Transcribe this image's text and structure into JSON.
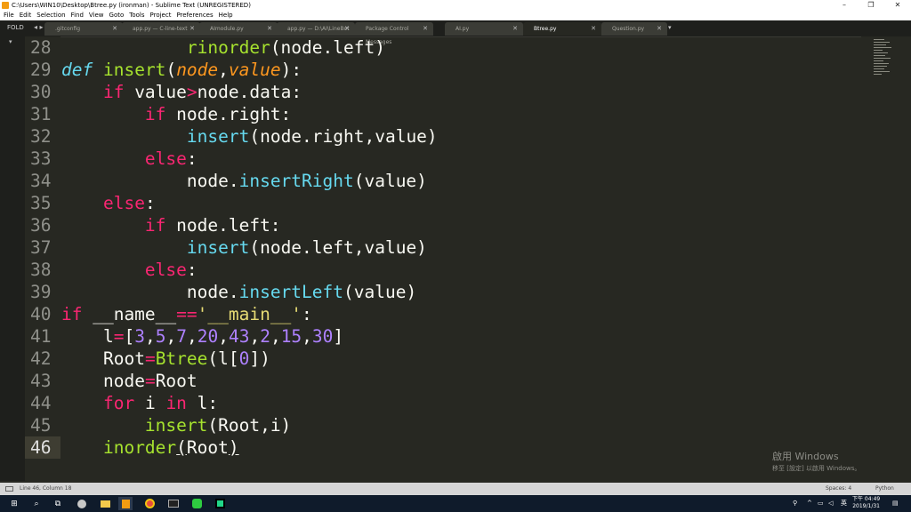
{
  "window": {
    "title": "C:\\Users\\WIN10\\Desktop\\Btree.py (ironman) - Sublime Text (UNREGISTERED)",
    "controls": [
      "–",
      "❐",
      "✕"
    ]
  },
  "menu": [
    "File",
    "Edit",
    "Selection",
    "Find",
    "View",
    "Goto",
    "Tools",
    "Project",
    "Preferences",
    "Help"
  ],
  "sidebar": {
    "label": "FOLD"
  },
  "tabs": [
    {
      "label": ".gitconfig"
    },
    {
      "label": "app.py — C-line-text"
    },
    {
      "label": "AImodule.py"
    },
    {
      "label": "app.py — D:\\AI\\LineBot"
    },
    {
      "label": "Package Control Messages"
    },
    {
      "label": "AI.py"
    },
    {
      "label": "Btree.py"
    },
    {
      "label": "Question.py"
    }
  ],
  "editor": {
    "line_numbers": [
      "28",
      "29",
      "30",
      "31",
      "32",
      "33",
      "34",
      "35",
      "36",
      "37",
      "38",
      "39",
      "40",
      "41",
      "42",
      "43",
      "44",
      "45",
      "46"
    ],
    "lines": {
      "l28": {
        "fn": "rinorder",
        "rest": "(node.left)"
      },
      "l29": {
        "kw": "def",
        "fn": "insert",
        "p1": "(",
        "a1": "node",
        "c": ",",
        "a2": "value",
        "p2": "):"
      },
      "l30": {
        "kw": "if",
        "a": " value",
        "op": ">",
        "b": "node.data:"
      },
      "l31": {
        "kw": "if",
        "rest": " node.right:"
      },
      "l32": {
        "fn": "insert",
        "rest": "(node.right,value)"
      },
      "l33": {
        "kw": "else",
        "rest": ":"
      },
      "l34": {
        "a": "node.",
        "fn": "insertRight",
        "rest": "(value)"
      },
      "l35": {
        "kw": "else",
        "rest": ":"
      },
      "l36": {
        "kw": "if",
        "rest": " node.left:"
      },
      "l37": {
        "fn": "insert",
        "rest": "(node.left,value)"
      },
      "l38": {
        "kw": "else",
        "rest": ":"
      },
      "l39": {
        "a": "node.",
        "fn": "insertLeft",
        "rest": "(value)"
      },
      "l40": {
        "kw": "if",
        "a": " __name__",
        "op": "==",
        "str": "'__main__'",
        "rest": ":"
      },
      "l41": {
        "a": "l",
        "op": "=",
        "b": "[",
        "nums": [
          "3",
          "5",
          "7",
          "20",
          "43",
          "2",
          "15",
          "30"
        ],
        "c": "]"
      },
      "l42": {
        "a": "Root",
        "op": "=",
        "fn": "Btree",
        "b": "(l[",
        "num": "0",
        "c": "])"
      },
      "l43": {
        "a": "node",
        "op": "=",
        "b": "Root"
      },
      "l44": {
        "kw1": "for",
        "a": " i ",
        "kw2": "in",
        "b": " l:"
      },
      "l45": {
        "fn": "insert",
        "rest": "(Root,i)"
      },
      "l46": {
        "fn": "inorder",
        "p1": "(",
        "a": "Root",
        "p2": ")"
      }
    }
  },
  "watermark": {
    "line1": "啟用 Windows",
    "line2": "移至 [設定] 以啟用 Windows。"
  },
  "statusbar": {
    "position": "Line 46, Column 18",
    "indent": "Spaces: 4",
    "syntax": "Python"
  },
  "taskbar": {
    "ime": "英",
    "clock_time": "下午 04:49",
    "clock_date": "2019/1/31"
  },
  "colors": {
    "bg": "#272822",
    "keyword": "#f92672",
    "function": "#a6e22e",
    "builtin": "#66d9ef",
    "param": "#fd971f",
    "number": "#ae81ff",
    "string": "#e6db74"
  }
}
